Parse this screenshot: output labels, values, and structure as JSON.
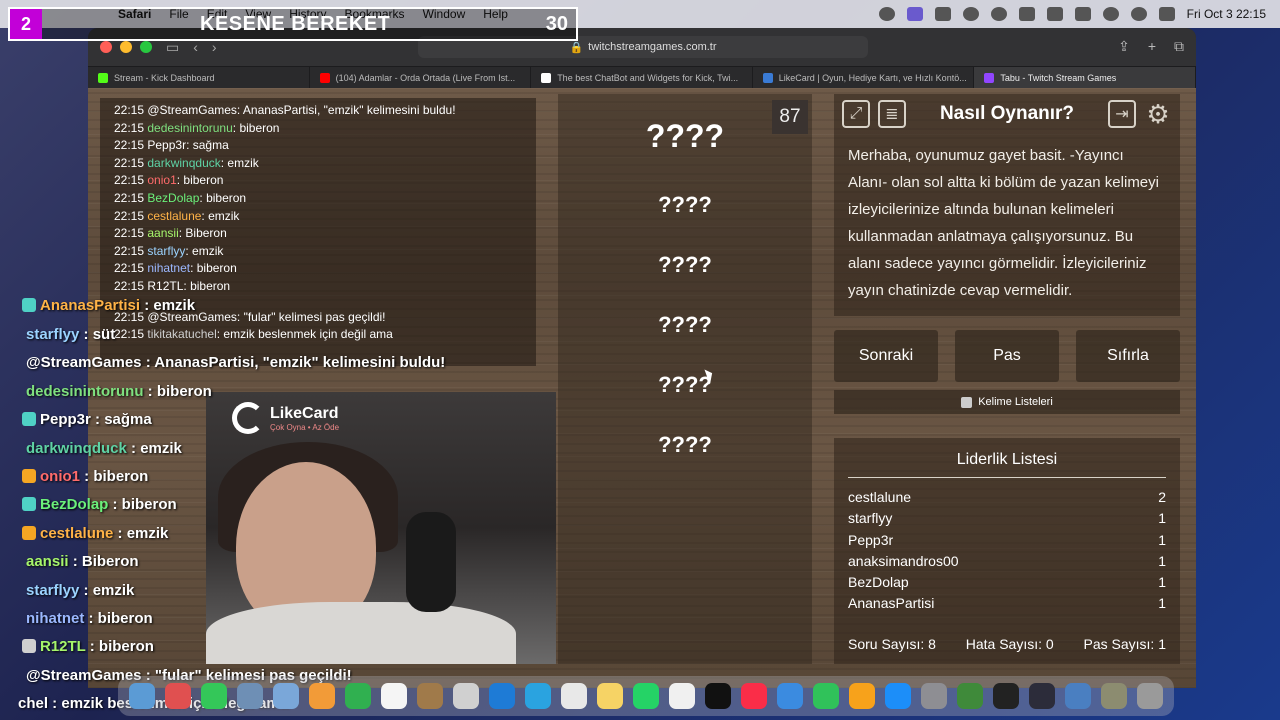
{
  "menubar": {
    "app": "Safari",
    "items": [
      "File",
      "Edit",
      "View",
      "History",
      "Bookmarks",
      "Window",
      "Help"
    ],
    "clock": "Fri Oct 3  22:15"
  },
  "browser": {
    "url": "twitchstreamgames.com.tr",
    "tabs": [
      {
        "label": "Stream - Kick Dashboard",
        "color": "#53fc18"
      },
      {
        "label": "(104) Adamlar - Orda Ortada (Live From Ist...",
        "color": "#ff0000"
      },
      {
        "label": "The best ChatBot and Widgets for Kick, Twi...",
        "color": "#ffffff"
      },
      {
        "label": "LikeCard | Oyun, Hediye Kartı, ve Hızlı Kontö...",
        "color": "#3a7bd5"
      },
      {
        "label": "Tabu - Twitch Stream Games",
        "color": "#9146ff",
        "active": true
      }
    ]
  },
  "chatlog": [
    {
      "time": "22:15",
      "user": "@StreamGames:",
      "msg": " Ananas​Partisi, \"emzik\" kelimesini buldu!",
      "color": "#ffffff"
    },
    {
      "time": "22:15",
      "user": "dedesinintorunu",
      "msg": ": biberon",
      "color": "#7fe07f"
    },
    {
      "time": "22:15",
      "user": "Pepp3r",
      "msg": ": sağma",
      "color": "#ffffff"
    },
    {
      "time": "22:15",
      "user": "darkwinqduck",
      "msg": ": emzik",
      "color": "#5fd3a5"
    },
    {
      "time": "22:15",
      "user": "onio1",
      "msg": ": biberon",
      "color": "#ff6b6b"
    },
    {
      "time": "22:15",
      "user": "BezDolap",
      "msg": ": biberon",
      "color": "#6bf07a"
    },
    {
      "time": "22:15",
      "user": "cestlalune",
      "msg": ": emzik",
      "color": "#ffb347"
    },
    {
      "time": "22:15",
      "user": "aansii",
      "msg": ": Biberon",
      "color": "#a6f56b"
    },
    {
      "time": "22:15",
      "user": "starflyy",
      "msg": ": emzik",
      "color": "#9bd3ff"
    },
    {
      "time": "22:15",
      "user": "nihatnet",
      "msg": ": biberon",
      "color": "#9bb8ff"
    },
    {
      "time": "22:15",
      "user": "R12TL",
      "msg": ": biberon",
      "color": "#ffffff"
    },
    {
      "time": "22:15",
      "user": "@StreamGames:",
      "msg": " \"fular\" kelimesi pas geçildi!",
      "color": "#ffffff"
    },
    {
      "time": "22:15",
      "user": "tikitakatuchel",
      "msg": ": emzik beslenmek için değil ama",
      "color": "#cfcfcf"
    }
  ],
  "words": {
    "timer": "87",
    "hidden": [
      "????",
      "????",
      "????",
      "????",
      "????",
      "????"
    ]
  },
  "howto": {
    "title": "Nasıl Oynanır?",
    "body": "Merhaba, oyunumuz gayet basit. -Yayıncı Alanı- olan sol altta ki bölüm de yazan kelimeyi izleyicilerinize altında bulunan kelimeleri kullanmadan anlatmaya çalışıyorsunuz. Bu alanı sadece yayıncı görmelidir. İzleyicileriniz yayın chatinizde cevap vermelidir."
  },
  "buttons": {
    "next": "Sonraki",
    "pass": "Pas",
    "reset": "Sıfırla",
    "word_lists": "Kelime Listeleri"
  },
  "leaderboard": {
    "title": "Liderlik Listesi",
    "rows": [
      {
        "name": "cestlalune",
        "score": "2"
      },
      {
        "name": "starflyy",
        "score": "1"
      },
      {
        "name": "Pepp3r",
        "score": "1"
      },
      {
        "name": "anaksimandros00",
        "score": "1"
      },
      {
        "name": "BezDolap",
        "score": "1"
      },
      {
        "name": "AnanasPartisi",
        "score": "1"
      }
    ],
    "questions": "Soru Sayısı: 8",
    "errors": "Hata Sayısı: 0",
    "passes": "Pas Sayısı: 1"
  },
  "overlay": {
    "number": "2",
    "title": "KESENE BEREKET",
    "count": "30"
  },
  "overlay_chat": [
    {
      "user": "AnanasPartisi",
      "msg": " : emzik",
      "color": "#ffb347",
      "badge": "#4fd1c5"
    },
    {
      "user": "starflyy",
      "msg": " : süt",
      "color": "#9bd3ff"
    },
    {
      "user": "@StreamGames",
      "msg": " : AnanasPartisi, \"emzik\" kelimesini buldu!",
      "color": "#ffffff"
    },
    {
      "user": "dedesinintorunu",
      "msg": " : biberon",
      "color": "#7fe07f"
    },
    {
      "user": "Pepp3r",
      "msg": " : sağma",
      "color": "#ffffff",
      "badge": "#4fd1c5"
    },
    {
      "user": "darkwinqduck",
      "msg": " : emzik",
      "color": "#5fd3a5"
    },
    {
      "user": "onio1",
      "msg": " : biberon",
      "color": "#ff6b6b",
      "badge": "#f5a623"
    },
    {
      "user": "BezDolap",
      "msg": " : biberon",
      "color": "#6bf07a",
      "badge": "#4fd1c5"
    },
    {
      "user": "cestlalune",
      "msg": " : emzik",
      "color": "#ffb347",
      "badge": "#f5a623"
    },
    {
      "user": "aansii",
      "msg": " : Biberon",
      "color": "#a6f56b"
    },
    {
      "user": "starflyy",
      "msg": " : emzik",
      "color": "#9bd3ff"
    },
    {
      "user": "nihatnet",
      "msg": " : biberon",
      "color": "#9bb8ff"
    },
    {
      "user": "R12TL",
      "msg": " : biberon",
      "color": "#a6f56b",
      "badge": "#d0d0d0"
    },
    {
      "user": "@StreamGames",
      "msg": " : \"fular\" kelimesi pas geçildi!",
      "color": "#ffffff"
    },
    {
      "user": "chel",
      "msg": " : emzik beslenmek için değil ama",
      "color": "#ffffff"
    }
  ],
  "likecard": {
    "name": "LikeCard",
    "tagline": "Çok Oyna • Az Öde"
  }
}
